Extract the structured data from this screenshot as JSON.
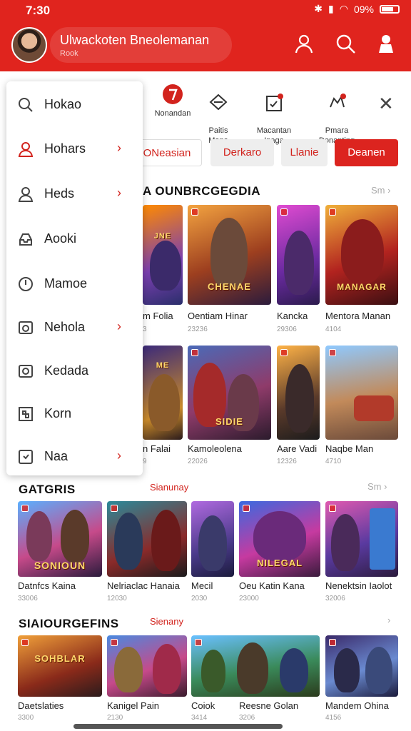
{
  "status": {
    "time": "7:30",
    "battery": "09%"
  },
  "header": {
    "name": "Ulwackoten Bneolemanan",
    "sub": "Rook"
  },
  "categories": [
    {
      "label": "Nonandan"
    },
    {
      "label": "Paitis\nMana"
    },
    {
      "label": "Macantan\nInaga"
    },
    {
      "label": "Pmara\nDonanting"
    }
  ],
  "chips": [
    "ONeasian",
    "Derkaro",
    "Llanie",
    "Deanen"
  ],
  "drawer": {
    "items": [
      {
        "label": "Hokao",
        "icon": "search-icon",
        "chevron": false
      },
      {
        "label": "Hohars",
        "icon": "user-icon",
        "chevron": true
      },
      {
        "label": "Heds",
        "icon": "person-icon",
        "chevron": true
      },
      {
        "label": "Aooki",
        "icon": "inbox-icon",
        "chevron": false
      },
      {
        "label": "Mamoe",
        "icon": "clock-icon",
        "chevron": false
      },
      {
        "label": "Nehola",
        "icon": "camera-icon",
        "chevron": true
      },
      {
        "label": "Kedada",
        "icon": "frame-icon",
        "chevron": false
      },
      {
        "label": "Korn",
        "icon": "grid-icon",
        "chevron": false
      },
      {
        "label": "Naa",
        "icon": "chat-icon",
        "chevron": true
      }
    ]
  },
  "section1": {
    "title": "A OUNBRCGEGDIA",
    "more": "Sm",
    "row1": [
      {
        "art": "JNE",
        "label": "m Folia",
        "count": "3"
      },
      {
        "art": "CHENAE",
        "label": "Oentiam Hinar",
        "count": "23236"
      },
      {
        "art": "",
        "label": "Kancka",
        "count": "29306"
      },
      {
        "art": "MANAGAR",
        "label": "Mentora Manan",
        "count": "4104"
      }
    ],
    "row2": [
      {
        "art": "ME",
        "label": "n Falai",
        "count": "9"
      },
      {
        "art": "SIDIE",
        "label": "Kamoleolena",
        "count": "22026"
      },
      {
        "art": "",
        "label": "Aare Vadi",
        "count": "12326"
      },
      {
        "art": "",
        "label": "Naqbe Man",
        "count": "4710"
      }
    ]
  },
  "section2": {
    "title": "GATGRIS",
    "link": "Sianunay",
    "more": "Sm",
    "cards": [
      {
        "art": "SONIOUN",
        "label": "Datnfcs Kaina",
        "count": "33006"
      },
      {
        "art": "",
        "label": "Nelriaclac Hanaia",
        "count": "12030"
      },
      {
        "art": "",
        "label": "Mecil",
        "count": "2030"
      },
      {
        "art": "NILEGAL",
        "label": "Oeu Katin Kana",
        "count": "23000"
      },
      {
        "art": "",
        "label": "Nenektsin Iaolot",
        "count": "32006"
      }
    ]
  },
  "section3": {
    "title": "SIAIOURGEFINS",
    "link": "Sienany",
    "cards": [
      {
        "art": "SOHBLAR",
        "label": "Daetslaties",
        "count": "3300"
      },
      {
        "art": "",
        "label": "Kanigel Pain",
        "count": "2130"
      },
      {
        "art": "",
        "label": "Coiok",
        "count": "3414"
      },
      {
        "art": "",
        "label": "Reesne Golan",
        "count": "3206"
      },
      {
        "art": "",
        "label": "Mandem Ohina",
        "count": "4156"
      }
    ]
  }
}
